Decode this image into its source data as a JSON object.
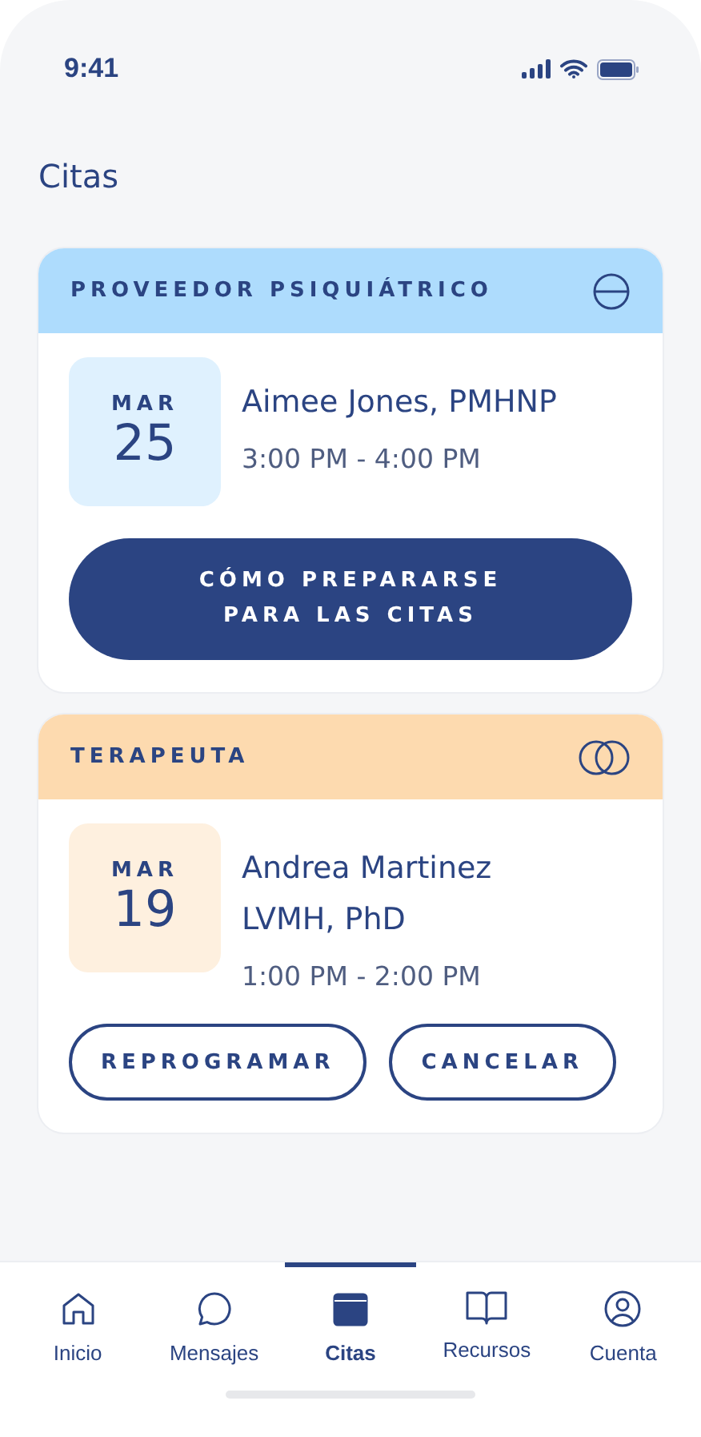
{
  "status_bar": {
    "time": "9:41"
  },
  "title": "Citas",
  "appointments": [
    {
      "kind": "psychiatric",
      "category": "PROVEEDOR PSIQUIÁTRICO",
      "color": "#aedcfd",
      "month": "MAR",
      "day": "25",
      "name_lines": [
        "Aimee Jones, PMHNP"
      ],
      "time": "3:00 PM - 4:00 PM",
      "buttons": [
        {
          "kind": "filled",
          "label": "CÓMO PREPARARSE\nPARA LAS CITAS"
        }
      ]
    },
    {
      "kind": "therapist",
      "category": "TERAPEUTA",
      "color": "#fddaaf",
      "month": "MAR",
      "day": "19",
      "name_lines": [
        "Andrea Martinez",
        "LVMH, PhD"
      ],
      "time": "1:00 PM - 2:00 PM",
      "buttons": [
        {
          "kind": "outline",
          "label": "REPROGRAMAR"
        },
        {
          "kind": "outline",
          "label": "CANCELAR"
        }
      ]
    }
  ],
  "tabs": [
    {
      "kind": "home",
      "label": "Inicio",
      "selected": false
    },
    {
      "kind": "chat",
      "label": "Mensajes",
      "selected": false
    },
    {
      "kind": "calendar",
      "label": "Citas",
      "selected": true
    },
    {
      "kind": "book",
      "label": "Recursos",
      "selected": false
    },
    {
      "kind": "account",
      "label": "Cuenta",
      "selected": false
    }
  ]
}
